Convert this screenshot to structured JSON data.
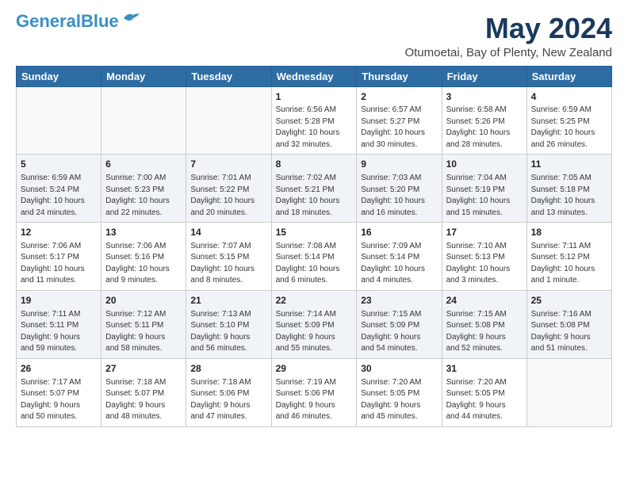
{
  "header": {
    "logo_line1": "General",
    "logo_line2": "Blue",
    "month": "May 2024",
    "location": "Otumoetai, Bay of Plenty, New Zealand"
  },
  "weekdays": [
    "Sunday",
    "Monday",
    "Tuesday",
    "Wednesday",
    "Thursday",
    "Friday",
    "Saturday"
  ],
  "weeks": [
    [
      {
        "day": "",
        "info": ""
      },
      {
        "day": "",
        "info": ""
      },
      {
        "day": "",
        "info": ""
      },
      {
        "day": "1",
        "info": "Sunrise: 6:56 AM\nSunset: 5:28 PM\nDaylight: 10 hours\nand 32 minutes."
      },
      {
        "day": "2",
        "info": "Sunrise: 6:57 AM\nSunset: 5:27 PM\nDaylight: 10 hours\nand 30 minutes."
      },
      {
        "day": "3",
        "info": "Sunrise: 6:58 AM\nSunset: 5:26 PM\nDaylight: 10 hours\nand 28 minutes."
      },
      {
        "day": "4",
        "info": "Sunrise: 6:59 AM\nSunset: 5:25 PM\nDaylight: 10 hours\nand 26 minutes."
      }
    ],
    [
      {
        "day": "5",
        "info": "Sunrise: 6:59 AM\nSunset: 5:24 PM\nDaylight: 10 hours\nand 24 minutes."
      },
      {
        "day": "6",
        "info": "Sunrise: 7:00 AM\nSunset: 5:23 PM\nDaylight: 10 hours\nand 22 minutes."
      },
      {
        "day": "7",
        "info": "Sunrise: 7:01 AM\nSunset: 5:22 PM\nDaylight: 10 hours\nand 20 minutes."
      },
      {
        "day": "8",
        "info": "Sunrise: 7:02 AM\nSunset: 5:21 PM\nDaylight: 10 hours\nand 18 minutes."
      },
      {
        "day": "9",
        "info": "Sunrise: 7:03 AM\nSunset: 5:20 PM\nDaylight: 10 hours\nand 16 minutes."
      },
      {
        "day": "10",
        "info": "Sunrise: 7:04 AM\nSunset: 5:19 PM\nDaylight: 10 hours\nand 15 minutes."
      },
      {
        "day": "11",
        "info": "Sunrise: 7:05 AM\nSunset: 5:18 PM\nDaylight: 10 hours\nand 13 minutes."
      }
    ],
    [
      {
        "day": "12",
        "info": "Sunrise: 7:06 AM\nSunset: 5:17 PM\nDaylight: 10 hours\nand 11 minutes."
      },
      {
        "day": "13",
        "info": "Sunrise: 7:06 AM\nSunset: 5:16 PM\nDaylight: 10 hours\nand 9 minutes."
      },
      {
        "day": "14",
        "info": "Sunrise: 7:07 AM\nSunset: 5:15 PM\nDaylight: 10 hours\nand 8 minutes."
      },
      {
        "day": "15",
        "info": "Sunrise: 7:08 AM\nSunset: 5:14 PM\nDaylight: 10 hours\nand 6 minutes."
      },
      {
        "day": "16",
        "info": "Sunrise: 7:09 AM\nSunset: 5:14 PM\nDaylight: 10 hours\nand 4 minutes."
      },
      {
        "day": "17",
        "info": "Sunrise: 7:10 AM\nSunset: 5:13 PM\nDaylight: 10 hours\nand 3 minutes."
      },
      {
        "day": "18",
        "info": "Sunrise: 7:11 AM\nSunset: 5:12 PM\nDaylight: 10 hours\nand 1 minute."
      }
    ],
    [
      {
        "day": "19",
        "info": "Sunrise: 7:11 AM\nSunset: 5:11 PM\nDaylight: 9 hours\nand 59 minutes."
      },
      {
        "day": "20",
        "info": "Sunrise: 7:12 AM\nSunset: 5:11 PM\nDaylight: 9 hours\nand 58 minutes."
      },
      {
        "day": "21",
        "info": "Sunrise: 7:13 AM\nSunset: 5:10 PM\nDaylight: 9 hours\nand 56 minutes."
      },
      {
        "day": "22",
        "info": "Sunrise: 7:14 AM\nSunset: 5:09 PM\nDaylight: 9 hours\nand 55 minutes."
      },
      {
        "day": "23",
        "info": "Sunrise: 7:15 AM\nSunset: 5:09 PM\nDaylight: 9 hours\nand 54 minutes."
      },
      {
        "day": "24",
        "info": "Sunrise: 7:15 AM\nSunset: 5:08 PM\nDaylight: 9 hours\nand 52 minutes."
      },
      {
        "day": "25",
        "info": "Sunrise: 7:16 AM\nSunset: 5:08 PM\nDaylight: 9 hours\nand 51 minutes."
      }
    ],
    [
      {
        "day": "26",
        "info": "Sunrise: 7:17 AM\nSunset: 5:07 PM\nDaylight: 9 hours\nand 50 minutes."
      },
      {
        "day": "27",
        "info": "Sunrise: 7:18 AM\nSunset: 5:07 PM\nDaylight: 9 hours\nand 48 minutes."
      },
      {
        "day": "28",
        "info": "Sunrise: 7:18 AM\nSunset: 5:06 PM\nDaylight: 9 hours\nand 47 minutes."
      },
      {
        "day": "29",
        "info": "Sunrise: 7:19 AM\nSunset: 5:06 PM\nDaylight: 9 hours\nand 46 minutes."
      },
      {
        "day": "30",
        "info": "Sunrise: 7:20 AM\nSunset: 5:05 PM\nDaylight: 9 hours\nand 45 minutes."
      },
      {
        "day": "31",
        "info": "Sunrise: 7:20 AM\nSunset: 5:05 PM\nDaylight: 9 hours\nand 44 minutes."
      },
      {
        "day": "",
        "info": ""
      }
    ]
  ]
}
